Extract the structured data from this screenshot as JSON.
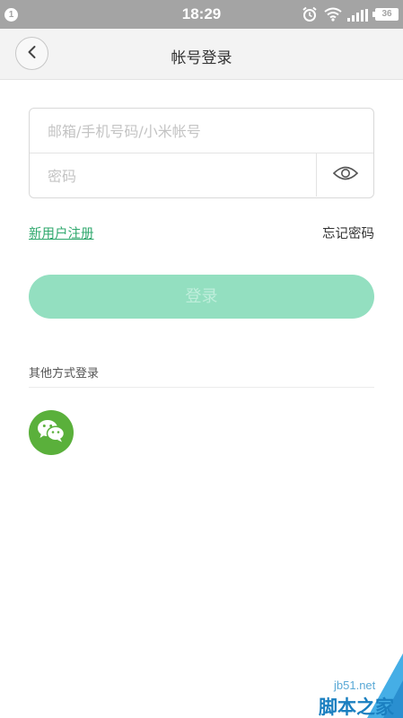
{
  "status_bar": {
    "notification_count": "1",
    "time": "18:29",
    "battery": "36",
    "icons": [
      "alarm-icon",
      "wifi-icon",
      "signal-icon",
      "battery-icon"
    ]
  },
  "header": {
    "title": "帐号登录",
    "back_icon": "chevron-left-icon"
  },
  "form": {
    "account_placeholder": "邮箱/手机号码/小米帐号",
    "password_placeholder": "密码",
    "toggle_icon": "eye-icon"
  },
  "links": {
    "register": "新用户注册",
    "forgot": "忘记密码"
  },
  "login_button": "登录",
  "other_methods": {
    "label": "其他方式登录",
    "icons": [
      "wechat-icon"
    ]
  },
  "watermark": {
    "site": "jb51.net",
    "name": "脚本之家"
  },
  "colors": {
    "status_bar": "#a4a4a4",
    "accent": "#2fa86d",
    "login_button": "#93dfc0",
    "wechat": "#5ab03b"
  }
}
